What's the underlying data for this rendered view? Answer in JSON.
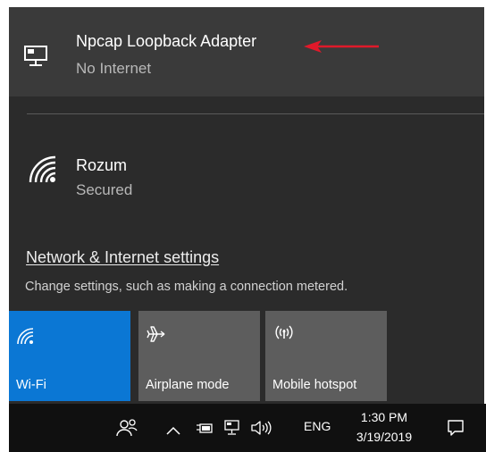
{
  "networks": [
    {
      "name": "Npcap Loopback Adapter",
      "status": "No Internet",
      "icon": "wired-network-icon"
    },
    {
      "name": "Rozum",
      "status": "Secured",
      "icon": "wifi-signal-icon"
    }
  ],
  "settings": {
    "link": "Network & Internet settings",
    "description": "Change settings, such as making a connection metered."
  },
  "quick_actions": [
    {
      "label": "Wi-Fi",
      "icon": "wifi-icon",
      "active": true
    },
    {
      "label": "Airplane mode",
      "icon": "airplane-icon",
      "active": false
    },
    {
      "label": "Mobile hotspot",
      "icon": "mobile-hotspot-icon",
      "active": false
    }
  ],
  "taskbar": {
    "language": "ENG",
    "time": "1:30 PM",
    "date": "3/19/2019"
  },
  "colors": {
    "accent": "#0b77d4",
    "annotation_arrow": "#e0192a",
    "flyout_bg": "#2b2b2b",
    "taskbar_bg": "#101010"
  }
}
